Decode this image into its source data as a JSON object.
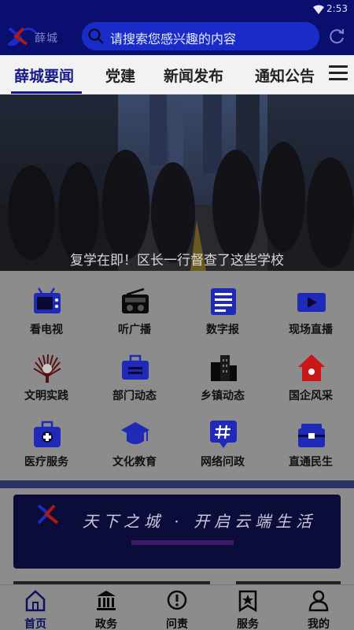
{
  "status": {
    "time": "2:53"
  },
  "header": {
    "logo_text": "薛城",
    "search_placeholder": "请搜索您感兴趣的内容"
  },
  "tabs": [
    {
      "label": "薛城要闻",
      "active": true
    },
    {
      "label": "党建"
    },
    {
      "label": "新闻发布"
    },
    {
      "label": "通知公告"
    }
  ],
  "banner": {
    "caption": "复学在即！区长一行督查了这些学校"
  },
  "services": [
    {
      "label": "看电视",
      "icon": "tv-icon"
    },
    {
      "label": "听广播",
      "icon": "radio-icon"
    },
    {
      "label": "数字报",
      "icon": "newspaper-icon"
    },
    {
      "label": "现场直播",
      "icon": "video-camera-icon"
    },
    {
      "label": "文明实践",
      "icon": "fan-emblem-icon"
    },
    {
      "label": "部门动态",
      "icon": "briefcase-icon"
    },
    {
      "label": "乡镇动态",
      "icon": "buildings-icon"
    },
    {
      "label": "国企风采",
      "icon": "house-icon"
    },
    {
      "label": "医疗服务",
      "icon": "medical-kit-icon"
    },
    {
      "label": "文化教育",
      "icon": "graduation-cap-icon"
    },
    {
      "label": "网络问政",
      "icon": "hashtag-chat-icon"
    },
    {
      "label": "直通民生",
      "icon": "toolbox-icon"
    }
  ],
  "promo": {
    "slogan": "天下之城 · 开启云端生活"
  },
  "bottom_nav": [
    {
      "label": "首页",
      "icon": "home-icon",
      "active": true
    },
    {
      "label": "政务",
      "icon": "government-building-icon"
    },
    {
      "label": "问责",
      "icon": "exclamation-circle-icon"
    },
    {
      "label": "服务",
      "icon": "star-bookmark-icon"
    },
    {
      "label": "我的",
      "icon": "user-icon"
    }
  ],
  "colors": {
    "header_bg": "#0a0e6e",
    "search_bg": "#1a2cc8",
    "accent": "#141a88",
    "icon_blue": "#1f2ab8"
  }
}
